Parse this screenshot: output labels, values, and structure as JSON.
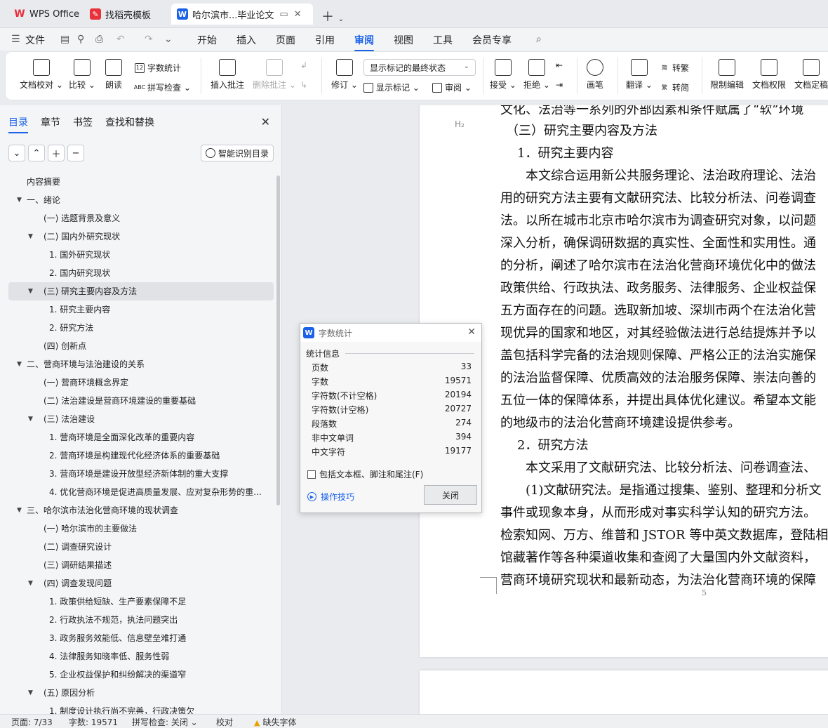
{
  "tabs": [
    {
      "label": "WPS Office",
      "icon": "wps-logo-icon",
      "color": "#e8313b"
    },
    {
      "label": "找稻壳模板",
      "icon": "docer-icon",
      "color": "#e8313b"
    },
    {
      "label": "哈尔滨市...毕业论文",
      "icon": "writer-icon",
      "color": "#1b62e8"
    }
  ],
  "menu": {
    "file": "文件",
    "items": [
      "开始",
      "插入",
      "页面",
      "引用",
      "审阅",
      "视图",
      "工具",
      "会员专享"
    ],
    "active": "审阅"
  },
  "ribbon": {
    "doc_check": "文档校对",
    "compare": "比较",
    "read_aloud": "朗读",
    "word_count": "字数统计",
    "spell_check": "拼写检查",
    "insert_comment": "插入批注",
    "delete_comment": "删除批注",
    "revise": "修订",
    "markup_select": "显示标记的最终状态",
    "show_markup": "显示标记",
    "review_pane": "审阅",
    "accept": "接受",
    "reject": "拒绝",
    "pen": "画笔",
    "translate": "翻译",
    "to_traditional": "转繁",
    "to_simplified": "转简",
    "restrict_edit": "限制编辑",
    "doc_permission": "文档权限",
    "doc_finalize": "文档定稿"
  },
  "nav": {
    "tabs": [
      "目录",
      "章节",
      "书签",
      "查找和替换"
    ],
    "smart_btn": "智能识别目录",
    "toc": [
      {
        "t": "内容摘要",
        "lvl": 0,
        "car": ""
      },
      {
        "t": "一、绪论",
        "lvl": 0,
        "car": "▼"
      },
      {
        "t": "(一) 选题背景及意义",
        "lvl": 1,
        "car": ""
      },
      {
        "t": "(二) 国内外研究现状",
        "lvl": 1,
        "car": "▼"
      },
      {
        "t": "1. 国外研究现状",
        "lvl": 2,
        "car": ""
      },
      {
        "t": "2. 国内研究现状",
        "lvl": 2,
        "car": ""
      },
      {
        "t": "(三) 研究主要内容及方法",
        "lvl": 1,
        "car": "▼",
        "sel": true
      },
      {
        "t": "1. 研究主要内容",
        "lvl": 2,
        "car": ""
      },
      {
        "t": "2. 研究方法",
        "lvl": 2,
        "car": ""
      },
      {
        "t": "(四) 创新点",
        "lvl": 1,
        "car": ""
      },
      {
        "t": "二、营商环境与法治建设的关系",
        "lvl": 0,
        "car": "▼"
      },
      {
        "t": "(一) 营商环境概念界定",
        "lvl": 1,
        "car": ""
      },
      {
        "t": "(二) 法治建设是营商环境建设的重要基础",
        "lvl": 1,
        "car": ""
      },
      {
        "t": "(三) 法治建设",
        "lvl": 1,
        "car": "▼"
      },
      {
        "t": "1. 营商环境是全面深化改革的重要内容",
        "lvl": 2,
        "car": ""
      },
      {
        "t": "2. 营商环境是构建现代化经济体系的重要基础",
        "lvl": 2,
        "car": ""
      },
      {
        "t": "3. 营商环境是建设开放型经济新体制的重大支撑",
        "lvl": 2,
        "car": ""
      },
      {
        "t": "4. 优化营商环境是促进高质量发展、应对复杂形势的重...",
        "lvl": 2,
        "car": ""
      },
      {
        "t": "三、哈尔滨市法治化营商环境的现状调查",
        "lvl": 0,
        "car": "▼"
      },
      {
        "t": "(一) 哈尔滨市的主要做法",
        "lvl": 1,
        "car": ""
      },
      {
        "t": "(二) 调查研究设计",
        "lvl": 1,
        "car": ""
      },
      {
        "t": "(三) 调研结果描述",
        "lvl": 1,
        "car": ""
      },
      {
        "t": "(四) 调查发现问题",
        "lvl": 1,
        "car": "▼"
      },
      {
        "t": "1. 政策供给短缺、生产要素保障不足",
        "lvl": 2,
        "car": ""
      },
      {
        "t": "2. 行政执法不规范，执法问题突出",
        "lvl": 2,
        "car": ""
      },
      {
        "t": "3. 政务服务效能低、信息壁垒难打通",
        "lvl": 2,
        "car": ""
      },
      {
        "t": "4. 法律服务知晓率低、服务性弱",
        "lvl": 2,
        "car": ""
      },
      {
        "t": "5. 企业权益保护和纠纷解决的渠道窄",
        "lvl": 2,
        "car": ""
      },
      {
        "t": "(五) 原因分析",
        "lvl": 1,
        "car": "▼"
      },
      {
        "t": "1. 制度设计执行尚不完善，行政决策欠",
        "lvl": 2,
        "car": ""
      }
    ]
  },
  "doc": {
    "heading_marker": "H₂",
    "lines": [
      "文化、法治等一系列的外部因素和条件赋属了“软”环境",
      "（三）研究主要内容及方法",
      "1．研究主要内容",
      "本文综合运用新公共服务理论、法治政府理论、法治",
      "用的研究方法主要有文献研究法、比较分析法、问卷调查",
      "法。以所在城市北京市哈尔滨市为调查研究对象，以问题",
      "深入分析，确保调研数据的真实性、全面性和实用性。通",
      "的分析，阐述了哈尔滨市在法治化营商环境优化中的做法",
      "政策供给、行政执法、政务服务、法律服务、企业权益保",
      "五方面存在的问题。选取新加坡、深圳市两个在法治化营",
      "现优异的国家和地区，对其经验做法进行总结提炼并予以",
      "盖包括科学完备的法治规则保障、严格公正的法治实施保",
      "的法治监督保障、优质高效的法治服务保障、崇法向善的",
      "五位一体的保障体系，并提出具体优化建议。希望本文能",
      "的地级市的法治化营商环境建设提供参考。",
      "2．研究方法",
      "本文采用了文献研究法、比较分析法、问卷调查法、",
      "(1)文献研究法。是指通过搜集、鉴别、整理和分析文",
      "事件或现象本身，从而形成对事实科学认知的研究方法。",
      "检索知网、万方、维普和 JSTOR 等中英文数据库，登陆相",
      "馆藏著作等各种渠道收集和查阅了大量国内外文献资料，",
      "营商环境研究现状和最新动态，为法治化营商环境的保障"
    ],
    "page_number": "5"
  },
  "dialog": {
    "title": "字数统计",
    "section": "统计信息",
    "stats": [
      {
        "k": "页数",
        "v": "33"
      },
      {
        "k": "字数",
        "v": "19571"
      },
      {
        "k": "字符数(不计空格)",
        "v": "20194"
      },
      {
        "k": "字符数(计空格)",
        "v": "20727"
      },
      {
        "k": "段落数",
        "v": "274"
      },
      {
        "k": "非中文单词",
        "v": "394"
      },
      {
        "k": "中文字符",
        "v": "19177"
      }
    ],
    "checkbox": "包括文本框、脚注和尾注(F)",
    "tips": "操作技巧",
    "close": "关闭"
  },
  "status": {
    "page": "页面: 7/33",
    "words": "字数: 19571",
    "spell": "拼写检查: 关闭",
    "proof": "校对",
    "missing_font": "缺失字体"
  }
}
